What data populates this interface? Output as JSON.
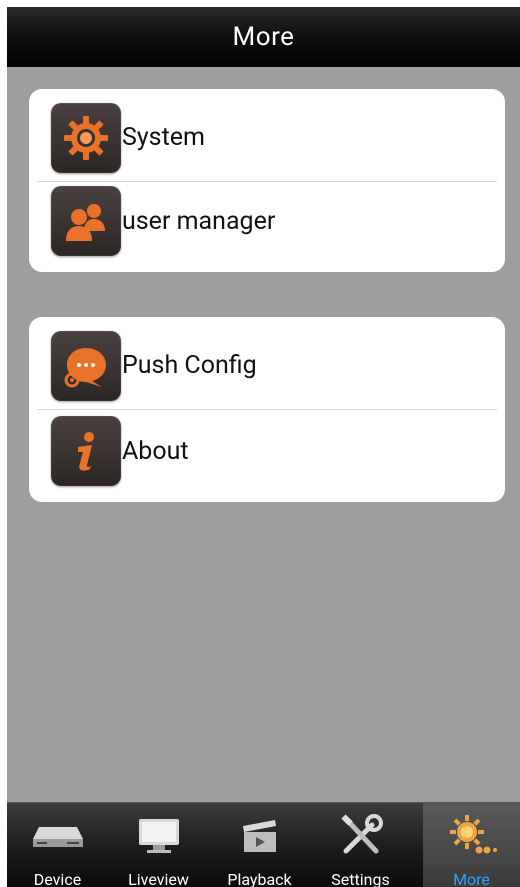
{
  "header": {
    "title": "More"
  },
  "menu_groups": [
    {
      "items": [
        {
          "label": "System",
          "icon": "gear-icon"
        },
        {
          "label": "user manager",
          "icon": "users-icon"
        }
      ]
    },
    {
      "items": [
        {
          "label": "Push Config",
          "icon": "chat-gear-icon"
        },
        {
          "label": "About",
          "icon": "info-icon"
        }
      ]
    }
  ],
  "tab_bar": {
    "tabs": [
      {
        "label": "Device",
        "icon": "dvr-device-icon"
      },
      {
        "label": "Liveview",
        "icon": "monitor-icon"
      },
      {
        "label": "Playback",
        "icon": "playback-clapper-icon"
      },
      {
        "label": "Settings",
        "icon": "tools-icon"
      },
      {
        "label": "More",
        "icon": "sun-more-icon",
        "active": true
      }
    ]
  },
  "colors": {
    "accent_orange": "#e8722a",
    "active_tab_label": "#29a3ff",
    "background": "#9e9e9e"
  }
}
